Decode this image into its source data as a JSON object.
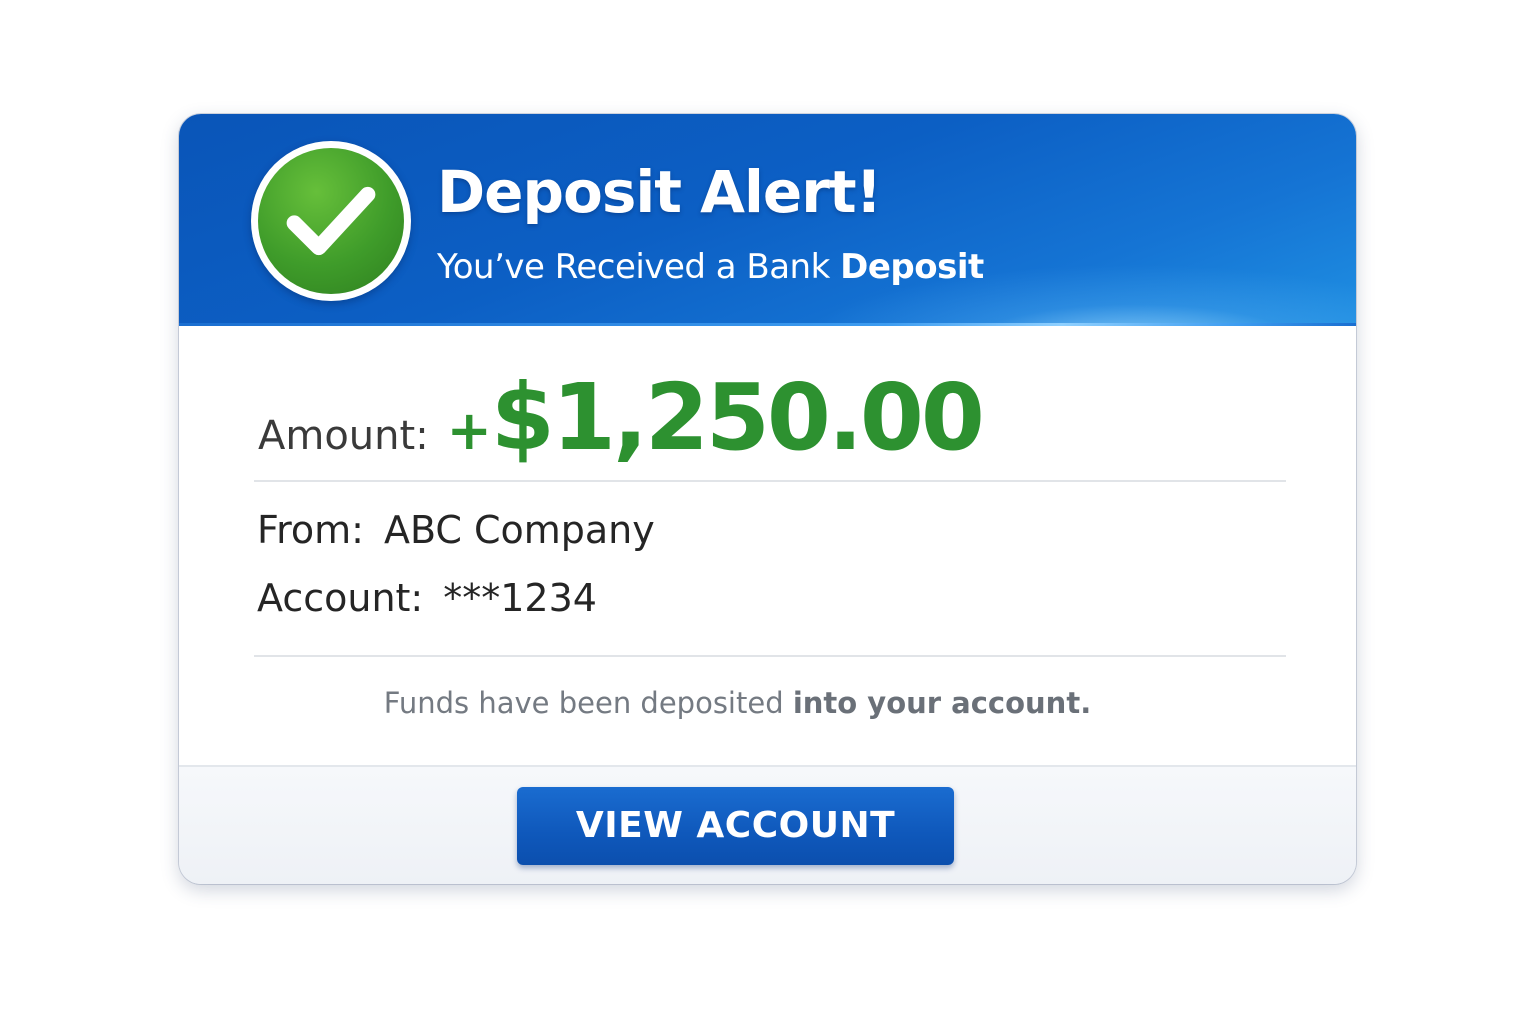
{
  "alert": {
    "title": "Deposit Alert!",
    "subtitle_regular": "You’ve Received a Bank ",
    "subtitle_bold": "Deposit",
    "icon": "checkmark-circle-icon"
  },
  "amount": {
    "label": "Amount:",
    "sign": "+",
    "value": "$1,250.00"
  },
  "details": {
    "from_label": "From:",
    "from_value": "ABC Company",
    "account_label": "Account:",
    "account_value": "***1234"
  },
  "note": {
    "regular": "Funds have been deposited ",
    "bold": "into your account."
  },
  "action": {
    "button_label": "VIEW ACCOUNT"
  },
  "colors": {
    "header_blue": "#0c5fc4",
    "amount_green": "#2d9130",
    "check_green": "#3f9c2a",
    "button_blue": "#0f58bb"
  }
}
